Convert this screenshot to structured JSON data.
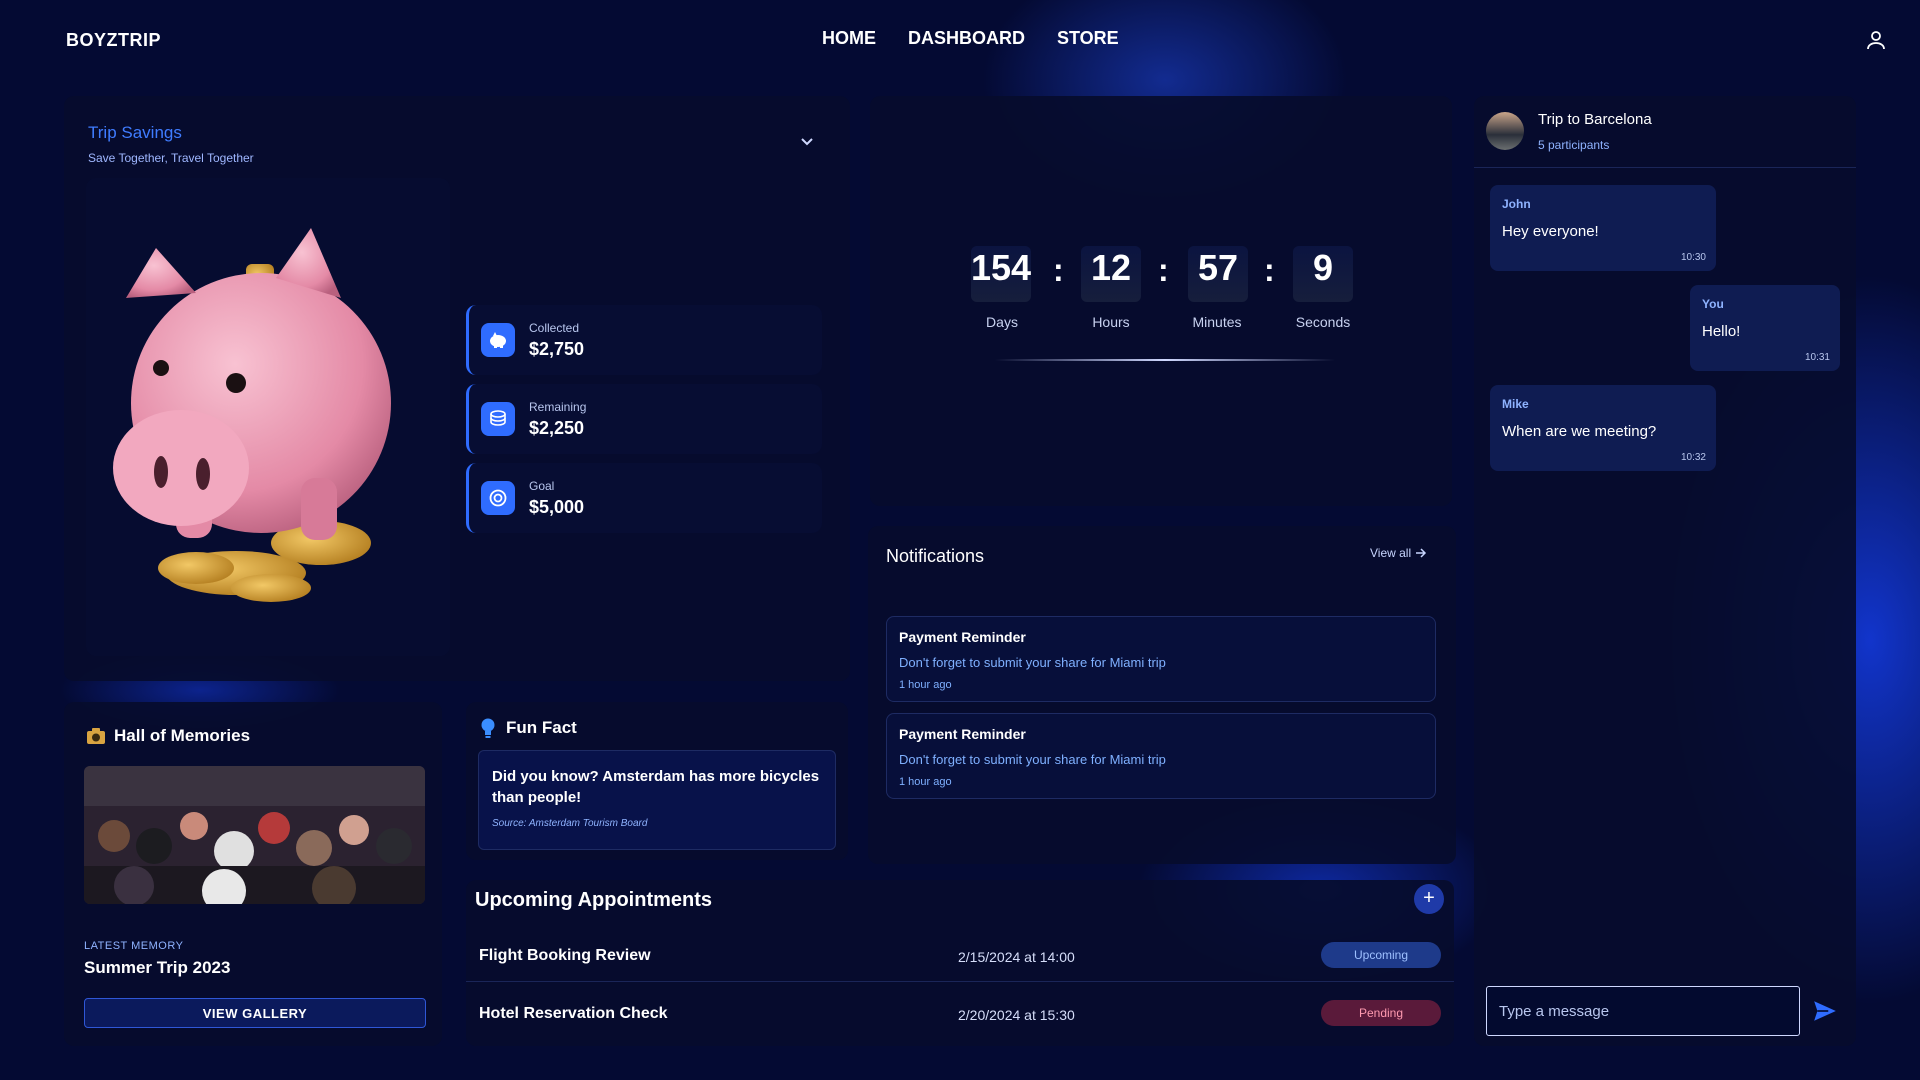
{
  "header": {
    "brand": "BOYZTRIP",
    "nav": [
      "HOME",
      "DASHBOARD",
      "STORE"
    ],
    "user_icon": "user-icon"
  },
  "savings": {
    "title": "Trip Savings",
    "subtitle": "Save Together, Travel Together",
    "stats": [
      {
        "label": "Collected",
        "value": "$2,750",
        "icon": "piggy-icon"
      },
      {
        "label": "Remaining",
        "value": "$2,250",
        "icon": "coins-icon"
      },
      {
        "label": "Goal",
        "value": "$5,000",
        "icon": "target-icon"
      }
    ],
    "accent": "#2f6cff"
  },
  "countdown": {
    "days": "154",
    "hours": "12",
    "minutes": "57",
    "seconds": "9",
    "labels": [
      "Days",
      "Hours",
      "Minutes",
      "Seconds"
    ],
    "separator": ":"
  },
  "notifications": {
    "title": "Notifications",
    "view_all": "View all",
    "items": [
      {
        "title": "Payment Reminder",
        "message": "Don't forget to submit your share for Miami trip",
        "time": "1 hour ago"
      },
      {
        "title": "Payment Reminder",
        "message": "Don't forget to submit your share for Miami trip",
        "time": "1 hour ago"
      }
    ]
  },
  "chat": {
    "title": "Trip to Barcelona",
    "participants": "5 participants",
    "messages": [
      {
        "sender": "John",
        "text": "Hey everyone!",
        "time": "10:30"
      },
      {
        "sender": "You",
        "text": "Hello!",
        "time": "10:31"
      },
      {
        "sender": "Mike",
        "text": "When are we meeting?",
        "time": "10:32"
      }
    ],
    "input_placeholder": "Type a message"
  },
  "memories": {
    "title": "Hall of Memories",
    "latest_label": "LATEST MEMORY",
    "latest_name": "Summer Trip 2023",
    "button": "VIEW GALLERY"
  },
  "fun_fact": {
    "title": "Fun Fact",
    "text": "Did you know? Amsterdam has more bicycles than people!",
    "source": "Source: Amsterdam Tourism Board"
  },
  "appointments": {
    "title": "Upcoming Appointments",
    "add": "+",
    "rows": [
      {
        "name": "Flight Booking Review",
        "date": "2/15/2024 at 14:00",
        "status": "Upcoming",
        "status_color": "#1e3a8a",
        "status_text_color": "#9ec0ff"
      },
      {
        "name": "Hotel Reservation Check",
        "date": "2/20/2024 at 15:30",
        "status": "Pending",
        "status_color": "#5a1a3a",
        "status_text_color": "#ff9ab0"
      }
    ]
  }
}
